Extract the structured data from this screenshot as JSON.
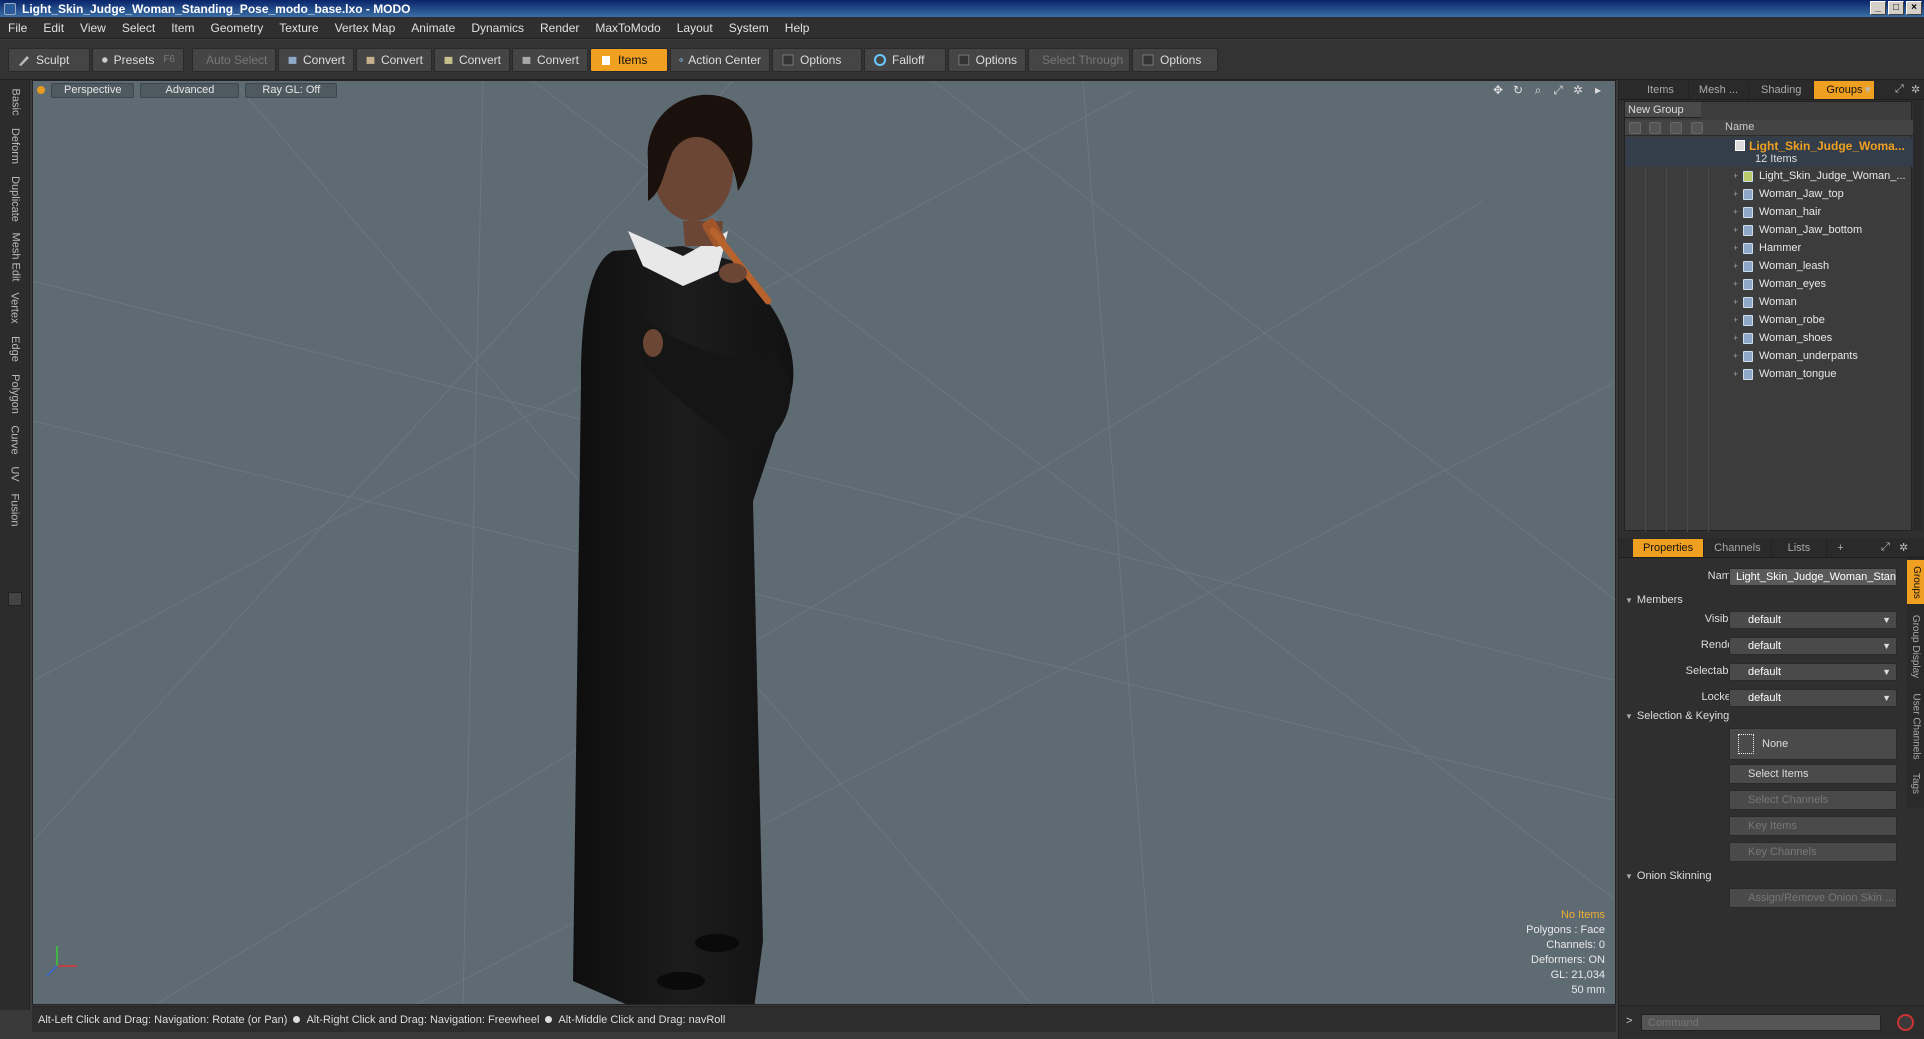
{
  "window": {
    "title": "Light_Skin_Judge_Woman_Standing_Pose_modo_base.lxo - MODO",
    "controls": [
      "_",
      "□",
      "×"
    ]
  },
  "menu": [
    "File",
    "Edit",
    "View",
    "Select",
    "Item",
    "Geometry",
    "Texture",
    "Vertex Map",
    "Animate",
    "Dynamics",
    "Render",
    "MaxToModo",
    "Layout",
    "System",
    "Help"
  ],
  "toolbar": {
    "sculpt": "Sculpt",
    "presets": "Presets",
    "presets_key": "F6",
    "auto_select": "Auto Select",
    "convert1": "Convert",
    "convert2": "Convert",
    "convert3": "Convert",
    "convert4": "Convert",
    "items": "Items",
    "action_center": "Action Center",
    "options1": "Options",
    "falloff": "Falloff",
    "options2": "Options",
    "select_through": "Select Through",
    "options3": "Options"
  },
  "left_tabs": [
    "Basic",
    "Deform",
    "Duplicate",
    "Mesh Edit",
    "Vertex",
    "Edge",
    "Polygon",
    "Curve",
    "UV",
    "Fusion"
  ],
  "viewport": {
    "view": "Perspective",
    "shading": "Advanced",
    "raygl": "Ray GL: Off",
    "info": {
      "items": "No Items",
      "polygons": "Polygons : Face",
      "channels": "Channels: 0",
      "deformers": "Deformers: ON",
      "gl": "GL: 21,034",
      "lens": "50 mm"
    }
  },
  "status": {
    "hint1": "Alt-Left Click and Drag: Navigation: Rotate (or Pan)",
    "hint2": "Alt-Right Click and Drag: Navigation: Freewheel",
    "hint3": "Alt-Middle Click and Drag: navRoll"
  },
  "groups_panel": {
    "tabs": [
      "Items",
      "Mesh ...",
      "Shading",
      "Groups"
    ],
    "active_tab": "Groups",
    "new_group": "New Group",
    "column_name": "Name",
    "group_name": "Light_Skin_Judge_Woma...",
    "group_count": "12 Items",
    "items": [
      "Light_Skin_Judge_Woman_...",
      "Woman_Jaw_top",
      "Woman_hair",
      "Woman_Jaw_bottom",
      "Hammer",
      "Woman_leash",
      "Woman_eyes",
      "Woman",
      "Woman_robe",
      "Woman_shoes",
      "Woman_underpants",
      "Woman_tongue"
    ]
  },
  "properties": {
    "tabs": [
      "Properties",
      "Channels",
      "Lists",
      "+"
    ],
    "name_label": "Name",
    "name_value": "Light_Skin_Judge_Woman_Stanc",
    "members": "Members",
    "visible_label": "Visible",
    "visible_value": "default",
    "render_label": "Render",
    "render_value": "default",
    "selectable_label": "Selectable",
    "selectable_value": "default",
    "locked_label": "Locked",
    "locked_value": "default",
    "selection_keying": "Selection & Keying",
    "none_btn": "None",
    "select_items": "Select Items",
    "select_channels": "Select Channels",
    "key_items": "Key Items",
    "key_channels": "Key Channels",
    "onion": "Onion Skinning",
    "assign_onion": "Assign/Remove Onion Skin ...",
    "side_tabs": [
      "Groups",
      "Group Display",
      "User Channels",
      "Tags"
    ]
  },
  "command": {
    "prompt": ">",
    "placeholder": "Command"
  },
  "colors": {
    "accent": "#f0a020",
    "viewport_bg": "#5e6b73"
  }
}
